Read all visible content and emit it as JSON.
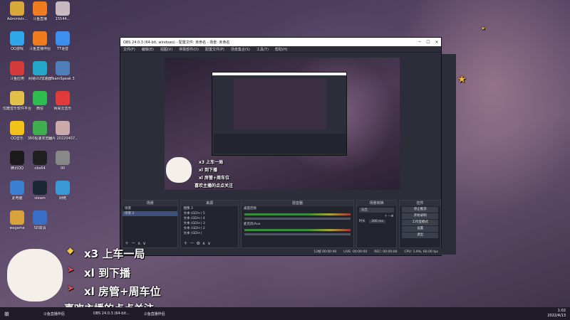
{
  "desktop_icons": [
    {
      "label": "Administr...",
      "color": "#d7a93a"
    },
    {
      "label": "斗鱼直播",
      "color": "#f07c1e"
    },
    {
      "label": "15544...",
      "color": "#c8b8c0"
    },
    {
      "label": "QQ游戏",
      "color": "#2fa7e8"
    },
    {
      "label": "斗鱼直播伴侣",
      "color": "#f07c1e"
    },
    {
      "label": "TT语音",
      "color": "#3e8ef0"
    },
    {
      "label": "斗鱼应用",
      "color": "#d33a3a"
    },
    {
      "label": "网易UU加速器",
      "color": "#23a8c8"
    },
    {
      "label": "TeamSpeak 3",
      "color": "#4f7fb8"
    },
    {
      "label": "优酷音乐软件平台",
      "color": "#e2c04a"
    },
    {
      "label": "微信",
      "color": "#2dbd4e"
    },
    {
      "label": "网易云音乐",
      "color": "#e03a3a"
    },
    {
      "label": "QQ音乐",
      "color": "#f2c21b"
    },
    {
      "label": "360极速浏览器",
      "color": "#3fae4f"
    },
    {
      "label": "图片 20220407...",
      "color": "#c9a9a9"
    },
    {
      "label": "腾讯QQ",
      "color": "#1a1a1a"
    },
    {
      "label": "obs64",
      "color": "#202020"
    },
    {
      "label": "00",
      "color": "#888888"
    },
    {
      "label": "此电脑",
      "color": "#3a7fd0"
    },
    {
      "label": "steam",
      "color": "#1b2838"
    },
    {
      "label": "网络",
      "color": "#3a9ad8"
    },
    {
      "label": "wegame",
      "color": "#d8a33a"
    },
    {
      "label": "SD高清",
      "color": "#3a6fc8"
    }
  ],
  "obs": {
    "title": "OBS 24.0.3 (64-bit, windows) - 配置文件: 未命名 - 场景: 未命名",
    "menu": [
      "文件(F)",
      "编辑(E)",
      "视图(V)",
      "停靠部件(D)",
      "配置文件(P)",
      "场景集合(S)",
      "工具(T)",
      "帮助(H)"
    ],
    "docks": {
      "scenes": {
        "title": "场景",
        "items": [
          "场景",
          "场景 2"
        ]
      },
      "sources": {
        "title": "来源",
        "items": [
          "图像 3",
          "文本 (GDI+) 5",
          "文本 (GDI+) 4",
          "文本 (GDI+) 3",
          "文本 (GDI+) 2",
          "文本 (GDI+)"
        ]
      },
      "mixer": {
        "title": "混音器",
        "items": [
          "桌面音频",
          "麦克风/Aux"
        ]
      },
      "transitions": {
        "title": "场景转换",
        "mode": "淡出",
        "duration_label": "时长",
        "duration_value": "300 ms"
      },
      "controls": {
        "title": "控件",
        "buttons": [
          "停止推流",
          "开始录制",
          "工作室模式",
          "设置",
          "退出"
        ]
      }
    },
    "status": {
      "live": "LIVE: 00:00:00",
      "rec": "REC: 00:00:00",
      "cpu": "CPU: 1.9%, 60.00 fps",
      "frames": "12帧  00:00:00"
    }
  },
  "overlay": {
    "lines": [
      "x3 上车一局",
      "xl 到下播",
      "xl 房管+周车位",
      "喜欢主播的点点关注"
    ]
  },
  "taskbar": {
    "items": [
      "斗鱼直播伴侣",
      "OBS 24.0.3 (64-bit...",
      "斗鱼直播伴侣"
    ],
    "time": "1:02",
    "date": "2022/4/13"
  }
}
